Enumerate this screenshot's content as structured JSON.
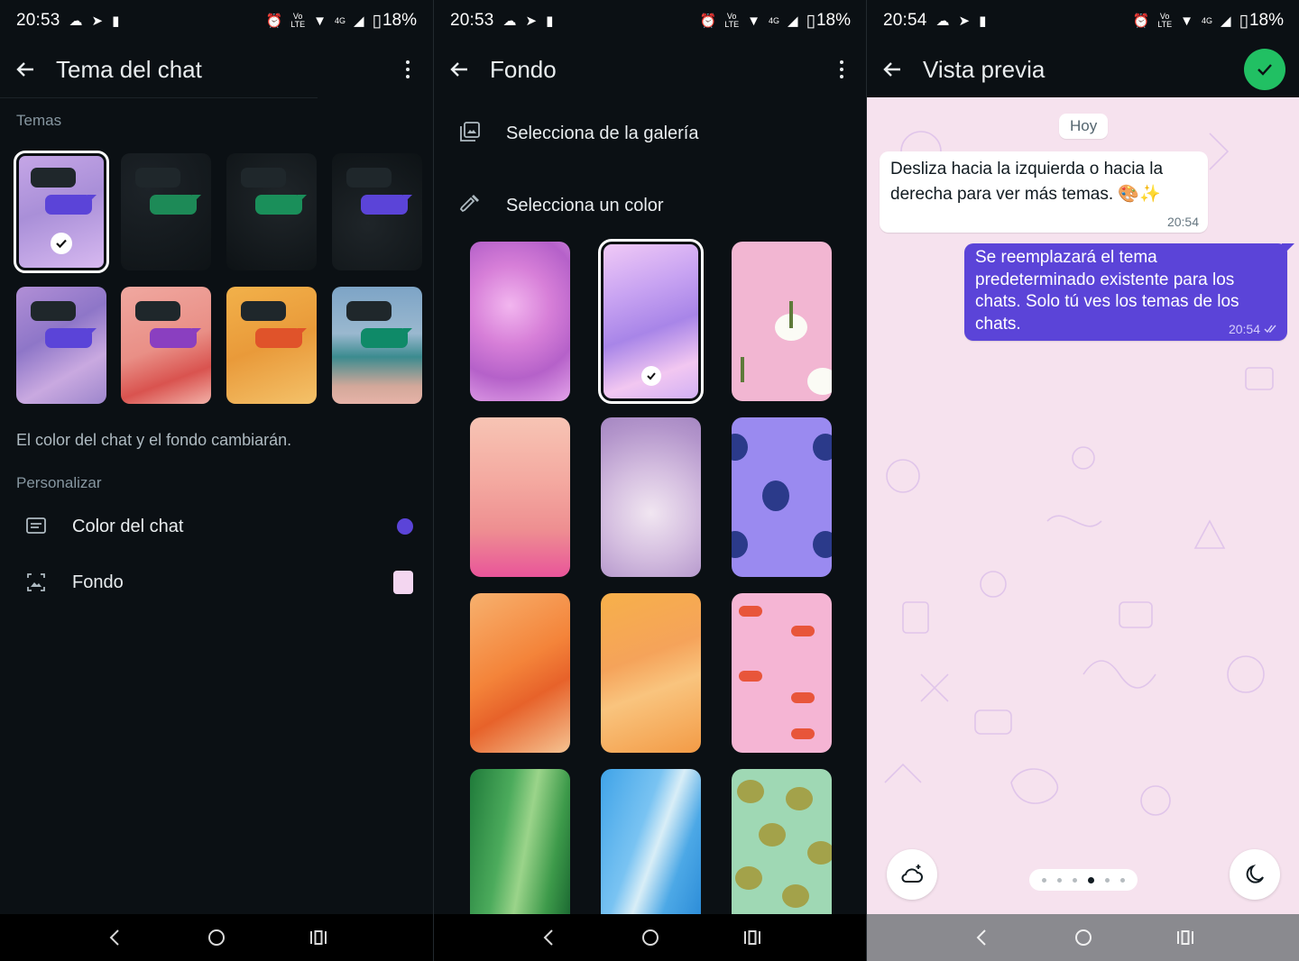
{
  "panel1": {
    "status": {
      "time": "20:53",
      "battery": "18%",
      "network": "4G"
    },
    "appbar": {
      "title": "Tema del chat"
    },
    "themes_label": "Temas",
    "themes": [
      {
        "name": "lavender",
        "bubble_color": "#5b44d8",
        "selected": true
      },
      {
        "name": "dark-green",
        "bubble_color": "#1d8a57",
        "selected": false
      },
      {
        "name": "dark-green-2",
        "bubble_color": "#1a8f5a",
        "selected": false
      },
      {
        "name": "dark-violet",
        "bubble_color": "#5b44d8",
        "selected": false
      },
      {
        "name": "purple-haze",
        "bubble_color": "#5b44d8",
        "selected": false
      },
      {
        "name": "pink-floral",
        "bubble_color": "#8a3fc0",
        "selected": false
      },
      {
        "name": "orange",
        "bubble_color": "#e0532a",
        "selected": false
      },
      {
        "name": "beach",
        "bubble_color": "#0f8a68",
        "selected": false
      }
    ],
    "description": "El color del chat y el fondo cambiarán.",
    "customize_label": "Personalizar",
    "chat_color": {
      "label": "Color del chat",
      "swatch": "#5b44d8"
    },
    "wallpaper": {
      "label": "Fondo",
      "swatch": "#f3d6f0"
    }
  },
  "panel2": {
    "status": {
      "time": "20:53",
      "battery": "18%",
      "network": "4G"
    },
    "appbar": {
      "title": "Fondo"
    },
    "gallery_label": "Selecciona de la galería",
    "color_label": "Selecciona un color",
    "wallpapers": [
      {
        "name": "pink-tulip",
        "selected": false
      },
      {
        "name": "iridescent",
        "selected": true
      },
      {
        "name": "palm-meringue",
        "selected": false
      },
      {
        "name": "coral-flowers",
        "selected": false
      },
      {
        "name": "dandelion",
        "selected": false
      },
      {
        "name": "figs-violet",
        "selected": false
      },
      {
        "name": "orange-lily",
        "selected": false
      },
      {
        "name": "orange-silk",
        "selected": false
      },
      {
        "name": "flip-flops",
        "selected": false
      },
      {
        "name": "green-leaf",
        "selected": false
      },
      {
        "name": "blue-water",
        "selected": false
      },
      {
        "name": "macarons",
        "selected": false
      }
    ]
  },
  "panel3": {
    "status": {
      "time": "20:54",
      "battery": "18%",
      "network": "4G"
    },
    "appbar": {
      "title": "Vista previa"
    },
    "date_chip": "Hoy",
    "incoming": {
      "text": "Desliza hacia la izquierda o hacia la derecha para ver más temas. 🎨✨",
      "time": "20:54"
    },
    "outgoing": {
      "text": "Se reemplazará el tema predeterminado existente para los chats. Solo tú ves los temas de los chats.",
      "time": "20:54"
    },
    "page_indicator": {
      "count": 6,
      "active_index": 3
    }
  },
  "colors": {
    "accent_green": "#21c063",
    "outgoing_bubble": "#5b44d8",
    "chat_bg": "#f6e2ee",
    "dark_bg": "#0b1014"
  }
}
